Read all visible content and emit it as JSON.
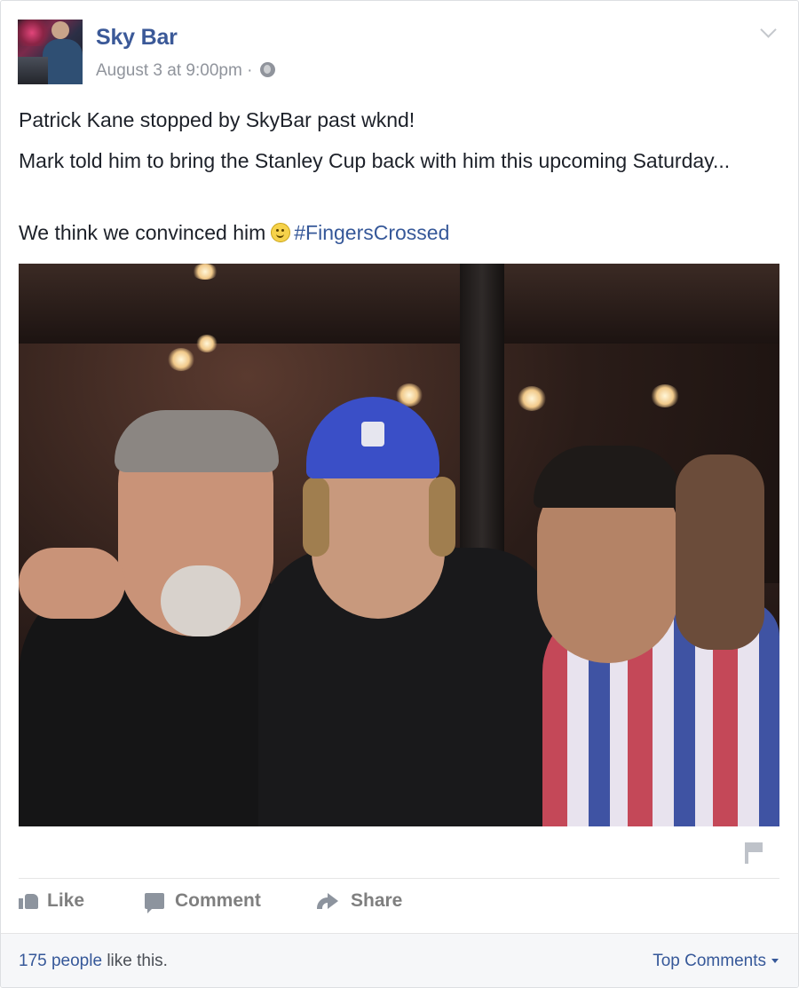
{
  "post": {
    "page_name": "Sky Bar",
    "timestamp": "August 3 at 9:00pm",
    "separator": "·",
    "privacy_icon": "globe-icon",
    "options_icon": "chevron-down-icon",
    "text": {
      "line1": "Patrick Kane stopped by SkyBar past wknd!",
      "line2": "Mark told him to bring the Stanley Cup back with him this upcoming Saturday...",
      "line3_prefix": "We think we convinced him",
      "emoji": "smiley-icon",
      "hashtag": "#FingersCrossed"
    }
  },
  "actions": {
    "like": "Like",
    "comment": "Comment",
    "share": "Share"
  },
  "footer": {
    "likes_count": "175 people",
    "likes_suffix": " like this.",
    "top_comments": "Top Comments"
  },
  "colors": {
    "link": "#365899",
    "page_name": "#3b5998",
    "meta": "#90949c",
    "action": "#7f7f7f"
  }
}
